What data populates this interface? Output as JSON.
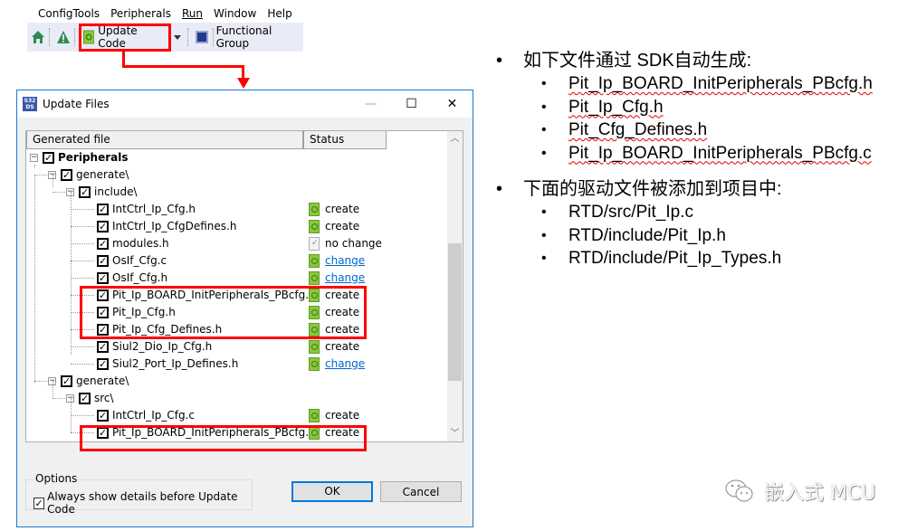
{
  "menu": {
    "items": [
      "ConfigTools",
      "Peripherals",
      "Run",
      "Window",
      "Help"
    ]
  },
  "toolbar": {
    "home_icon": "home-icon",
    "warning_icon": "warning-icon",
    "update_code_label": "Update Code",
    "functional_group_label": "Functional Group"
  },
  "dialog": {
    "title": "Update Files",
    "logo_text": "S32 DS",
    "columns": {
      "generated_file": "Generated file",
      "status": "Status"
    },
    "tree": [
      {
        "label": "Peripherals",
        "level": 0,
        "bold": true,
        "expander": "−",
        "status": ""
      },
      {
        "label": "generate\\",
        "level": 1,
        "expander": "−",
        "status": ""
      },
      {
        "label": "include\\",
        "level": 2,
        "expander": "−",
        "status": ""
      },
      {
        "label": "IntCtrl_Ip_Cfg.h",
        "level": 3,
        "status": "create"
      },
      {
        "label": "IntCtrl_Ip_CfgDefines.h",
        "level": 3,
        "status": "create"
      },
      {
        "label": "modules.h",
        "level": 3,
        "status": "no change"
      },
      {
        "label": "OsIf_Cfg.c",
        "level": 3,
        "status": "change"
      },
      {
        "label": "OsIf_Cfg.h",
        "level": 3,
        "status": "change"
      },
      {
        "label": "Pit_Ip_BOARD_InitPeripherals_PBcfg.h",
        "level": 3,
        "status": "create"
      },
      {
        "label": "Pit_Ip_Cfg.h",
        "level": 3,
        "status": "create"
      },
      {
        "label": "Pit_Ip_Cfg_Defines.h",
        "level": 3,
        "status": "create"
      },
      {
        "label": "Siul2_Dio_Ip_Cfg.h",
        "level": 3,
        "status": "create"
      },
      {
        "label": "Siul2_Port_Ip_Defines.h",
        "level": 3,
        "status": "change"
      },
      {
        "label": "generate\\",
        "level": 1,
        "expander": "−",
        "status": ""
      },
      {
        "label": "src\\",
        "level": 2,
        "expander": "−",
        "status": ""
      },
      {
        "label": "IntCtrl_Ip_Cfg.c",
        "level": 3,
        "status": "create"
      },
      {
        "label": "Pit_Ip_BOARD_InitPeripherals_PBcfg.c",
        "level": 3,
        "status": "create"
      }
    ],
    "options_legend": "Options",
    "always_show_label": "Always show details before Update Code",
    "always_show_checked": true,
    "ok_label": "OK",
    "cancel_label": "Cancel",
    "scroll_position": 0.45
  },
  "slide": {
    "section1_title": "如下文件通过 SDK自动生成:",
    "section1_items": [
      "Pit_Ip_BOARD_InitPeripherals_PBcfg.h",
      "Pit_Ip_Cfg.h",
      "Pit_Cfg_Defines.h",
      "Pit_Ip_BOARD_InitPeripherals_PBcfg.c"
    ],
    "section2_title": "下面的驱动文件被添加到项目中:",
    "section2_items": [
      "RTD/src/Pit_Ip.c",
      "RTD/include/Pit_Ip.h",
      "RTD/include/Pit_Ip_Types.h"
    ]
  },
  "watermark": {
    "text": "嵌入式 MCU"
  },
  "colors": {
    "highlight": "#ff0000",
    "accent": "#0078d7",
    "link": "#0066cc"
  }
}
